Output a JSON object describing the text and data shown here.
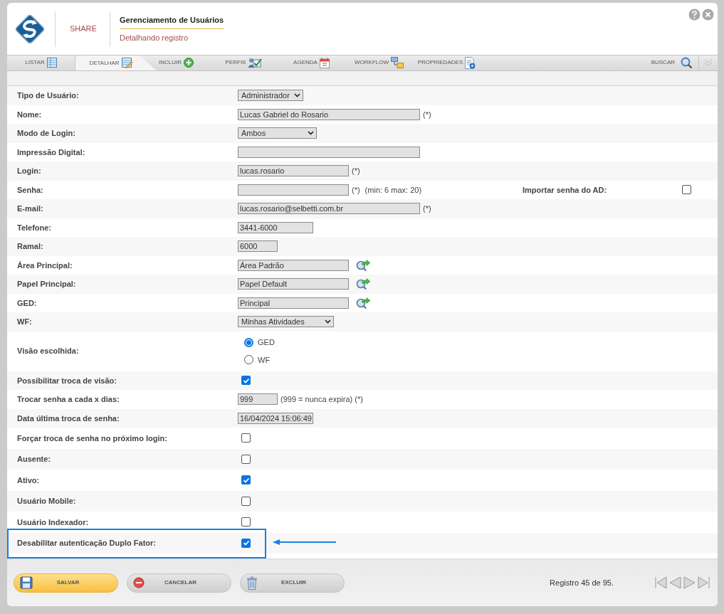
{
  "header": {
    "brand": "SHARE",
    "title": "Gerenciamento de Usuários",
    "subtitle": "Detalhando registro"
  },
  "tabs": [
    {
      "label": "LISTAR",
      "selected": false
    },
    {
      "label": "DETALHAR",
      "selected": true
    },
    {
      "label": "INCLUIR",
      "selected": false
    },
    {
      "label": "PERFIS",
      "selected": false
    },
    {
      "label": "AGENDA",
      "selected": false
    },
    {
      "label": "WORKFLOW",
      "selected": false
    },
    {
      "label": "PROPRIEDADES",
      "selected": false
    }
  ],
  "search_tab": {
    "label": "BUSCAR"
  },
  "rows": [
    {
      "kind": "select",
      "label": "Tipo de Usuário:",
      "value": "Administrador"
    },
    {
      "kind": "text",
      "label": "Nome:",
      "value": "Lucas Gabriel do Rosario",
      "suffix": "(*)"
    },
    {
      "kind": "select",
      "label": "Modo de Login:",
      "value": "Ambos"
    },
    {
      "kind": "text",
      "label": "Impressão Digital:"
    },
    {
      "kind": "text",
      "label": "Login:",
      "value": "lucas.rosario",
      "suffix": "(*)"
    },
    {
      "kind": "text",
      "label": "Senha:",
      "suffix": "(*)",
      "hint": "(min: 6 max: 20)",
      "extra": {
        "label": "Importar senha do AD:",
        "checked": false
      }
    },
    {
      "kind": "text",
      "label": "E-mail:",
      "value": "lucas.rosario@selbetti.com.br",
      "suffix": "(*)"
    },
    {
      "kind": "text",
      "label": "Telefone:",
      "value": "3441-6000"
    },
    {
      "kind": "text",
      "label": "Ramal:",
      "value": "6000"
    },
    {
      "kind": "lookup",
      "label": "Área Principal:",
      "value": "Área Padrão"
    },
    {
      "kind": "lookup",
      "label": "Papel Principal:",
      "value": "Papel Default"
    },
    {
      "kind": "lookup",
      "label": "GED:",
      "value": "Principal"
    },
    {
      "kind": "select",
      "label": "WF:",
      "value": "Minhas Atividades"
    },
    {
      "kind": "radio",
      "label": "Visão escolhida:",
      "options": [
        {
          "label": "GED",
          "selected": true
        },
        {
          "label": "WF",
          "selected": false
        }
      ]
    },
    {
      "kind": "checkbox",
      "label": "Possibilitar troca de visão:",
      "checked": true
    },
    {
      "kind": "text",
      "label": "Trocar senha a cada x dias:",
      "value": "999",
      "suffix": "(999 = nunca expira) (*)"
    },
    {
      "kind": "text",
      "label": "Data última troca de senha:",
      "value": "16/04/2024 15:06:49"
    },
    {
      "kind": "checkbox",
      "label": "Forçar troca de senha no próximo login:",
      "checked": false
    },
    {
      "kind": "checkbox",
      "label": "Ausente:",
      "checked": false
    },
    {
      "kind": "checkbox",
      "label": "Ativo:",
      "checked": true
    },
    {
      "kind": "checkbox",
      "label": "Usuário Mobile:",
      "checked": false
    },
    {
      "kind": "checkbox",
      "label": "Usuário Indexador:",
      "checked": false
    },
    {
      "kind": "checkbox",
      "label": "Desabilitar autenticação Duplo Fator:",
      "checked": true,
      "highlighted": true
    }
  ],
  "buttons": [
    {
      "kind": "primary",
      "label": "SALVAR"
    },
    {
      "kind": "default",
      "label": "CANCELAR"
    },
    {
      "kind": "default",
      "label": "EXCLUIR"
    }
  ],
  "record_counter": "Registro 45 de 95."
}
